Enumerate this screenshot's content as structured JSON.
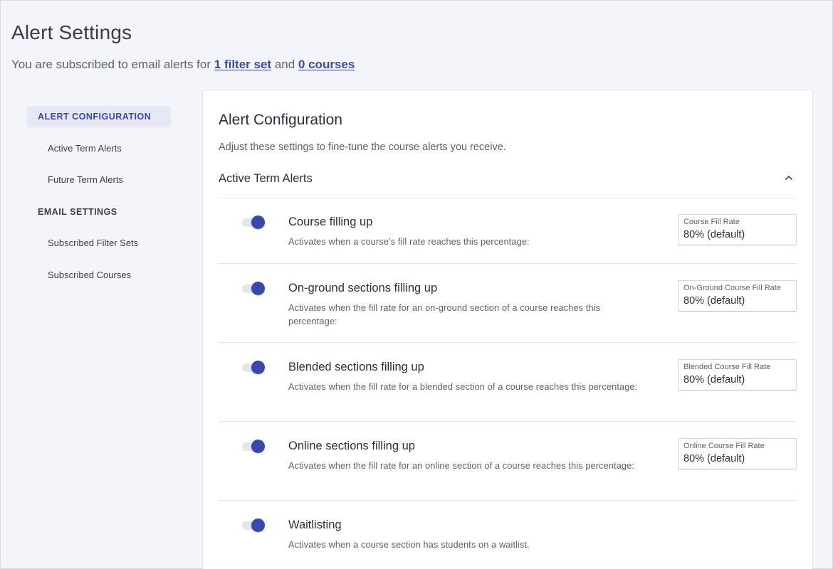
{
  "header": {
    "title": "Alert Settings",
    "subtitle_prefix": "You are subscribed to email alerts for",
    "filter_link": "1 filter set",
    "and_text": "and",
    "courses_link": "0 courses"
  },
  "sidebar": {
    "items": [
      {
        "label": "ALERT CONFIGURATION"
      },
      {
        "label": "Active Term Alerts"
      },
      {
        "label": "Future Term Alerts"
      },
      {
        "label": "EMAIL SETTINGS"
      },
      {
        "label": "Subscribed Filter Sets"
      },
      {
        "label": "Subscribed Courses"
      }
    ]
  },
  "main": {
    "title": "Alert Configuration",
    "description": "Adjust these settings to fine-tune the course alerts you receive.",
    "section_label": "Active Term Alerts",
    "alerts": [
      {
        "title": "Course filling up",
        "description": "Activates when a course’s fill rate reaches this percentage:",
        "enabled": true,
        "field_label": "Course Fill Rate",
        "field_value": "80% (default)"
      },
      {
        "title": "On-ground sections filling up",
        "description": "Activates when the fill rate for an on-ground section of a course reaches this percentage:",
        "enabled": true,
        "field_label": "On-Ground Course Fill Rate",
        "field_value": "80% (default)"
      },
      {
        "title": "Blended sections filling up",
        "description": "Activates when the fill rate for a blended section of a course reaches this percentage:",
        "enabled": true,
        "field_label": "Blended Course Fill Rate",
        "field_value": "80% (default)"
      },
      {
        "title": "Online sections filling up",
        "description": "Activates when the fill rate for an online section of a course reaches this percentage:",
        "enabled": true,
        "field_label": "Online Course Fill Rate",
        "field_value": "80% (default)"
      },
      {
        "title": "Waitlisting",
        "description": "Activates when a course section has students on a waitlist.",
        "enabled": true
      }
    ]
  },
  "colors": {
    "accent": "#3949ab",
    "background": "#f4f5fa",
    "active_nav_bg": "#e6e8f6",
    "toggle_track": "#e3e5ef"
  },
  "icons": {
    "collapse": "chevron-up-icon"
  }
}
